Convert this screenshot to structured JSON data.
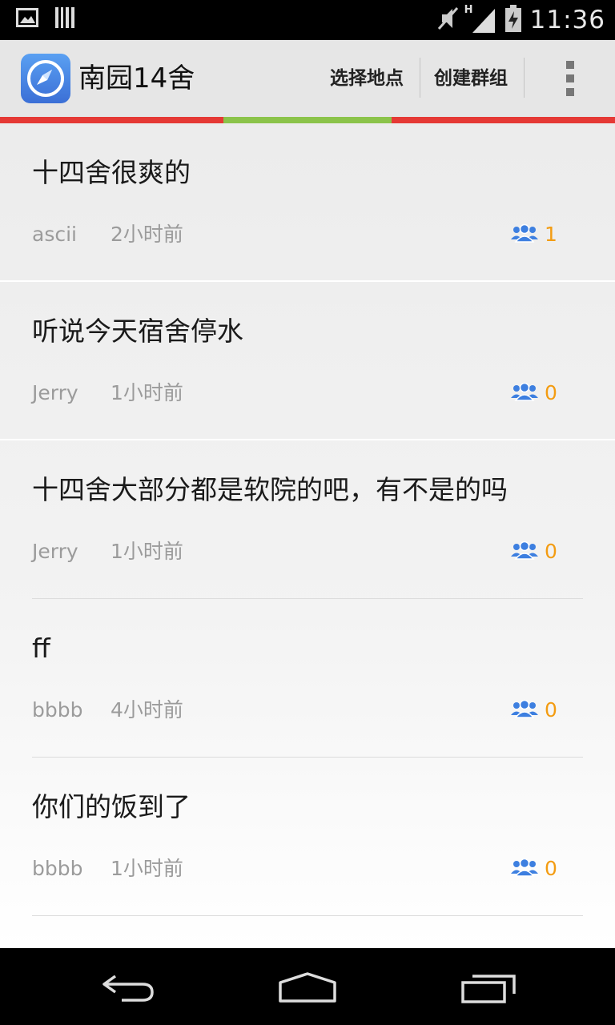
{
  "status_bar": {
    "time": "11:36",
    "network_label": "H",
    "icons": [
      "image-notification-icon",
      "barcode-notification-icon",
      "mute-icon",
      "signal-icon",
      "battery-charging-icon"
    ]
  },
  "action_bar": {
    "title": "南园14舍",
    "app_icon": "compass-icon",
    "actions": [
      {
        "label": "选择地点"
      },
      {
        "label": "创建群组"
      }
    ],
    "overflow_icon": "overflow-menu-icon"
  },
  "tab_indicator": {
    "colors": [
      "#e53935",
      "#8bc34a",
      "#e53935"
    ]
  },
  "posts": [
    {
      "title": "十四舍很爽的",
      "user": "ascii",
      "time": "2小时前",
      "count": "1"
    },
    {
      "title": "听说今天宿舍停水",
      "user": "Jerry",
      "time": "1小时前",
      "count": "0"
    },
    {
      "title": "十四舍大部分都是软院的吧，有不是的吗",
      "user": "Jerry",
      "time": "1小时前",
      "count": "0"
    },
    {
      "title": "ff",
      "user": "bbbb",
      "time": "4小时前",
      "count": "0"
    },
    {
      "title": "你们的饭到了",
      "user": "bbbb",
      "time": "1小时前",
      "count": "0"
    }
  ],
  "colors": {
    "accent_orange": "#f39c12",
    "people_icon_blue": "#3d7fe0"
  },
  "nav_bar": {
    "icons": [
      "back-icon",
      "home-icon",
      "recent-apps-icon"
    ]
  }
}
